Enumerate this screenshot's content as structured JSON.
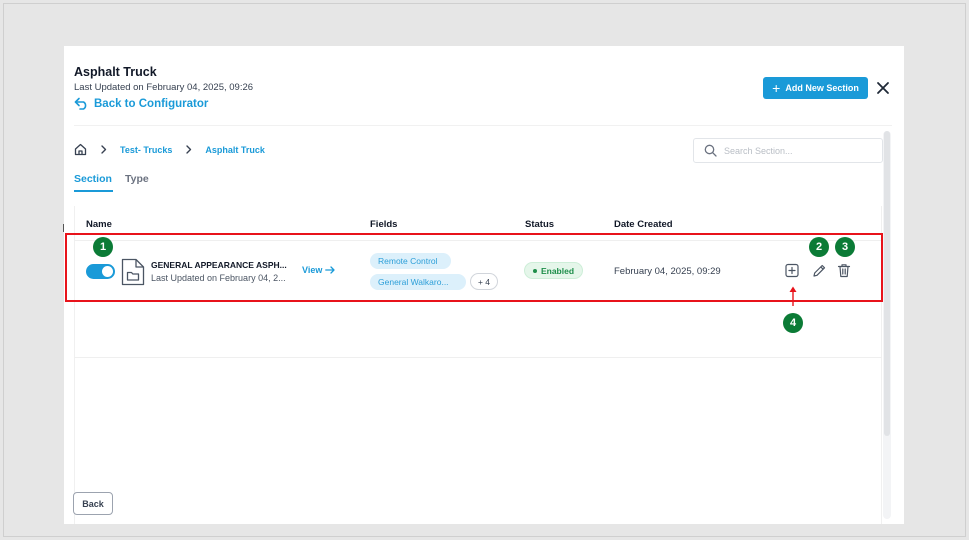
{
  "header": {
    "title": "Asphalt Truck",
    "subtitle": "Last Updated on February 04, 2025, 09:26",
    "back_link": "Back to Configurator",
    "add_button": "Add New Section"
  },
  "breadcrumbs": [
    "Test- Trucks",
    "Asphalt Truck"
  ],
  "search": {
    "placeholder": "Search Section..."
  },
  "tabs": [
    {
      "label": "Section",
      "active": true
    },
    {
      "label": "Type",
      "active": false
    }
  ],
  "table": {
    "columns": [
      "Name",
      "Fields",
      "Status",
      "Date Created"
    ],
    "rows": [
      {
        "enabled": true,
        "name": "GENERAL APPEARANCE ASPH...",
        "updated": "Last Updated on February 04, 2...",
        "view": "View",
        "fields": [
          "Remote Control",
          "General Walkaro..."
        ],
        "more_fields": "+ 4",
        "status": "Enabled",
        "date_created": "February 04, 2025, 09:29"
      }
    ]
  },
  "callouts": [
    "1",
    "2",
    "3",
    "4"
  ],
  "footer": {
    "back_button": "Back"
  },
  "colors": {
    "accent": "#1a9ad8",
    "highlight": "#e8131b",
    "callout": "#0b7b36",
    "status_enabled": "#1e8e4a"
  },
  "icons": {
    "back": "undo-arrow-icon",
    "add": "plus-icon",
    "close": "close-icon",
    "home": "home-icon",
    "chevron": "chevron-right-icon",
    "search": "search-icon",
    "file": "file-folder-icon",
    "view": "arrow-right-icon",
    "row_add": "plus-square-icon",
    "row_edit": "pencil-icon",
    "row_delete": "trash-icon"
  }
}
